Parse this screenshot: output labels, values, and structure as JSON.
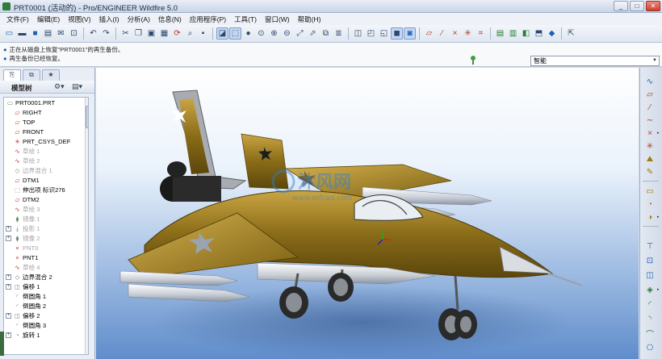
{
  "window": {
    "title": "PRT0001 (活动的) - Pro/ENGINEER Wildfire 5.0"
  },
  "menu": [
    "文件(F)",
    "编辑(E)",
    "视图(V)",
    "插入(I)",
    "分析(A)",
    "信息(N)",
    "应用程序(P)",
    "工具(T)",
    "窗口(W)",
    "帮助(H)"
  ],
  "messages": [
    "正在从磁盘上恢复\"PRT0001\"的再生备份。",
    "再生备份已经恢复。"
  ],
  "filter": {
    "value": "智能"
  },
  "navigator": {
    "header": "模型树"
  },
  "tree": [
    {
      "label": "PRT0001.PRT",
      "icon": "part-icon",
      "dim": false
    },
    {
      "label": "RIGHT",
      "icon": "datum-plane-icon",
      "dim": false
    },
    {
      "label": "TOP",
      "icon": "datum-plane-icon",
      "dim": false
    },
    {
      "label": "FRONT",
      "icon": "datum-plane-icon",
      "dim": false
    },
    {
      "label": "PRT_CSYS_DEF",
      "icon": "csys-icon",
      "dim": false
    },
    {
      "label": "草绘 1",
      "icon": "sketch-icon",
      "dim": true
    },
    {
      "label": "草绘 2",
      "icon": "sketch-icon",
      "dim": true
    },
    {
      "label": "边界混合 1",
      "icon": "boundary-blend-icon",
      "dim": true
    },
    {
      "label": "DTM1",
      "icon": "datum-plane-icon",
      "dim": false
    },
    {
      "label": "伸出项 标识276",
      "icon": "protrusion-icon",
      "dim": false
    },
    {
      "label": "DTM2",
      "icon": "datum-plane-icon",
      "dim": false
    },
    {
      "label": "草绘 3",
      "icon": "sketch-icon",
      "dim": true
    },
    {
      "label": "镜像 1",
      "icon": "mirror-icon",
      "dim": true
    },
    {
      "label": "投影 1",
      "icon": "projection-icon",
      "dim": true
    },
    {
      "label": "镜像 2",
      "icon": "mirror-icon",
      "dim": true
    },
    {
      "label": "PNT0",
      "icon": "datum-point-icon",
      "dim": true
    },
    {
      "label": "PNT1",
      "icon": "datum-point-icon",
      "dim": false
    },
    {
      "label": "草绘 4",
      "icon": "sketch-icon",
      "dim": true
    },
    {
      "label": "边界混合 2",
      "icon": "boundary-blend-icon",
      "dim": false
    },
    {
      "label": "偏移 1",
      "icon": "offset-icon",
      "dim": false
    },
    {
      "label": "倒圆角 1",
      "icon": "round-icon",
      "dim": false
    },
    {
      "label": "倒圆角 2",
      "icon": "round-icon",
      "dim": false
    },
    {
      "label": "偏移 2",
      "icon": "offset-icon",
      "dim": false
    },
    {
      "label": "倒圆角 3",
      "icon": "round-icon",
      "dim": false
    },
    {
      "label": "旋转 1",
      "icon": "revolve-icon",
      "dim": false
    }
  ],
  "watermark": {
    "brand": "沐风网",
    "url": "www.mfcad.com"
  },
  "colors": {
    "viewport_top": "#ffffff",
    "viewport_bottom": "#5f8dcb",
    "model_body": "#8a6c18",
    "model_highlight": "#c9a543",
    "missile": "#d7dde6"
  }
}
